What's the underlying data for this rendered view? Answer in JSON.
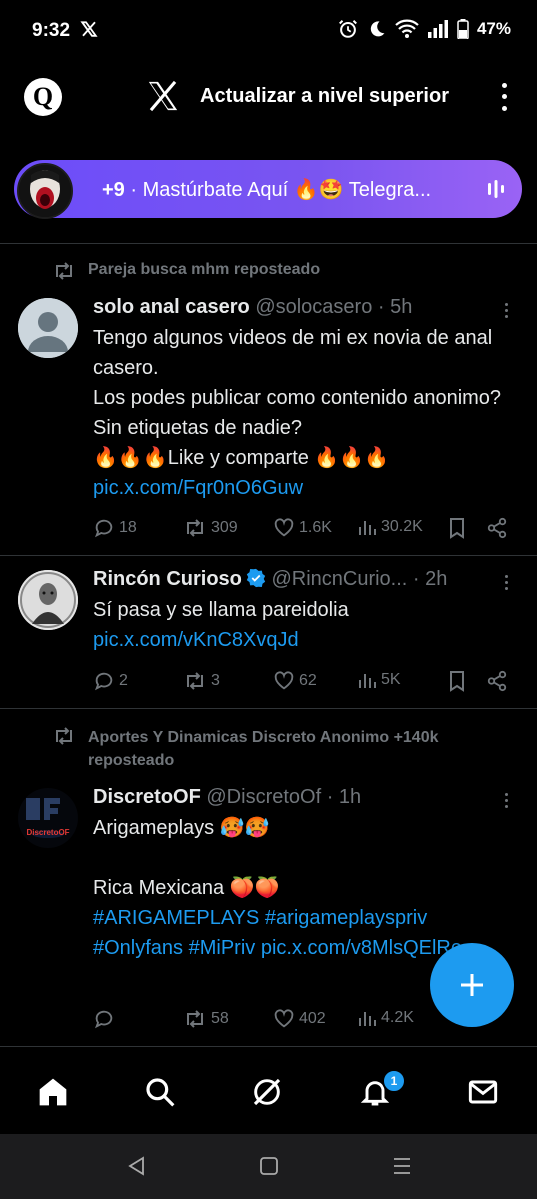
{
  "status": {
    "time": "9:32",
    "battery": "47%"
  },
  "topbar": {
    "avatar_letter": "Q",
    "upgrade_label": "Actualizar a nivel superior"
  },
  "spaces": {
    "count": "+9",
    "text": " · Mastúrbate Aquí 🔥🤩 Telegra..."
  },
  "tweets": [
    {
      "repost_by": "Pareja busca mhm reposteado",
      "name": "solo anal casero",
      "handle": "@solocasero · 5h",
      "text": "Tengo algunos videos de mi ex novia de anal casero.\nLos podes publicar como contenido anonimo? Sin etiquetas de nadie?\n🔥🔥🔥Like y comparte 🔥🔥🔥",
      "link": "pic.x.com/Fqr0nO6Guw",
      "replies": "18",
      "reposts": "309",
      "likes": "1.6K",
      "views": "30.2K"
    },
    {
      "name": "Rincón Curioso",
      "handle": "@RincnCurio... · 2h",
      "text": "Sí pasa y se llama pareidolia ",
      "link": "pic.x.com/vKnC8XvqJd",
      "replies": "2",
      "reposts": "3",
      "likes": "62",
      "views": "5K"
    },
    {
      "repost_by": "Aportes Y Dinamicas Discreto Anonimo +140k reposteado",
      "avatar_label": "DiscretoOF",
      "name": "DiscretoOF",
      "handle": "@DiscretoOf · 1h",
      "text": "Arigameplays 🥵🥵\n\nRica Mexicana 🍑🍑",
      "link": "#ARIGAMEPLAYS #arigameplayspriv #Onlyfans #MiPriv pic.x.com/v8MlsQElRe",
      "reposts": "58",
      "likes": "402",
      "views": "4.2K"
    }
  ],
  "bottom_nav": {
    "notification_count": "1"
  },
  "colors": {
    "accent": "#1d9bf0",
    "muted": "#71767b",
    "spaces_gradient_start": "#6c4dfa"
  }
}
